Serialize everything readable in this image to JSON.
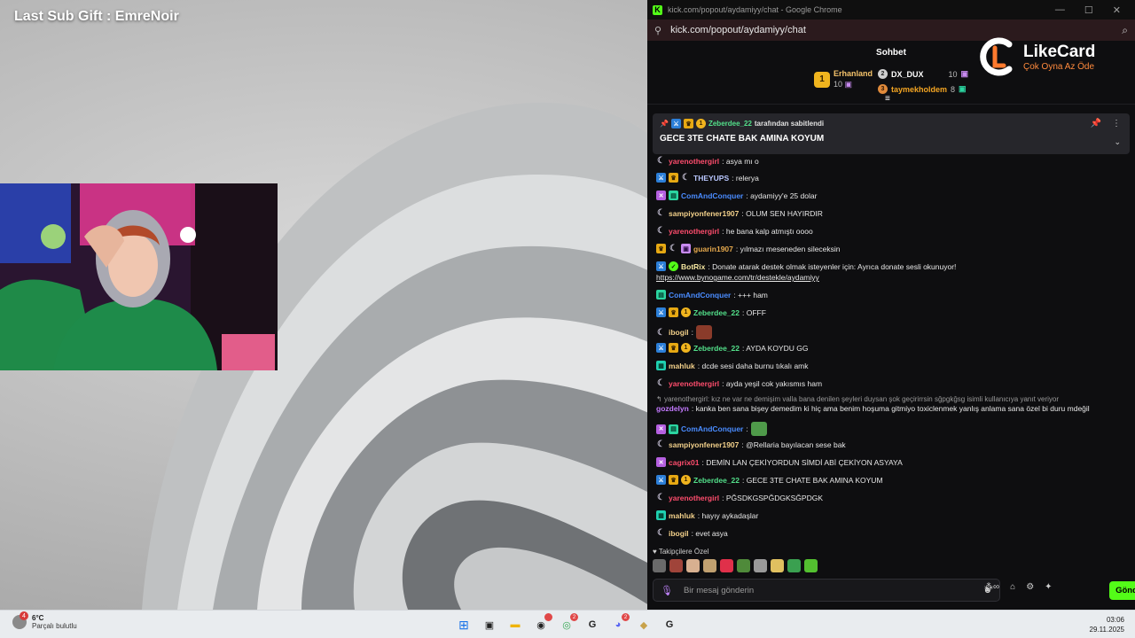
{
  "overlay": {
    "title": "Last Sub Gift : EmreNoir"
  },
  "browser": {
    "window_title": "kick.com/popout/aydamiyy/chat - Google Chrome",
    "url": "kick.com/popout/aydamiyy/chat"
  },
  "chat": {
    "title": "Sohbet",
    "top_gifters": [
      {
        "rank": "1",
        "name": "Erhanland",
        "count": "10",
        "color": "#f5c36b"
      },
      {
        "rank": "2",
        "name": "DX_DUX",
        "count": "10",
        "color": "#ffffff"
      },
      {
        "rank": "3",
        "name": "taymekholdem",
        "count": "8",
        "color": "#f5a623"
      }
    ],
    "pinned": {
      "badge_rank": "1",
      "user": "Zeberdee_22",
      "suffix": "tarafından sabitlendi",
      "message": "GECE 3TE CHATE BAK AMINA KOYUM"
    },
    "messages": [
      {
        "user": "yarenothergirl",
        "text": ": asya mı o",
        "color": "#ff4d6d"
      },
      {
        "user": "THEYUPS",
        "text": ": relerya",
        "color": "#b9c7ff"
      },
      {
        "user": "ComAndConquer",
        "text": ": aydamiyy'e 25 dolar",
        "color": "#4a8cff"
      },
      {
        "user": "sampiyonfener1907",
        "text": ": OLUM SEN HAYIRDIR",
        "color": "#f2d08a"
      },
      {
        "user": "yarenothergirl",
        "text": ": he bana kalp atmıştı oooo",
        "color": "#ff4d6d"
      },
      {
        "user": "guarin1907",
        "text": ": yılmazı meseneden sileceksin",
        "color": "#e6a94d"
      },
      {
        "user": "BotRix",
        "text": ": Donate atarak destek olmak isteyenler için: Ayrıca donate sesli okunuyor!",
        "color": "#f5e6a0",
        "link": "https://www.bynogame.com/tr/destekle/aydamiyy"
      },
      {
        "user": "ComAndConquer",
        "text": ": +++ ham",
        "color": "#4a8cff"
      },
      {
        "user": "Zeberdee_22",
        "text": ": OFFF",
        "color": "#53e08a"
      },
      {
        "user": "ibogil",
        "text": ":",
        "color": "#f2d08a"
      },
      {
        "user": "Zeberdee_22",
        "text": ": AYDA KOYDU GG",
        "color": "#53e08a"
      },
      {
        "user": "mahluk",
        "text": ": dcde sesi daha burnu tıkalı amk",
        "color": "#f2d08a"
      },
      {
        "user": "yarenothergirl",
        "text": ": ayda yeşil cok yakısmıs ham",
        "color": "#ff4d6d"
      },
      {
        "user": "gozdelyn",
        "text": ": kanka ben sana bişey demedim ki hiç ama benim hoşuma gitmiyo toxiclenmek yanlış anlama sana özel bi duru mdeğil",
        "color": "#c47aff",
        "reply": "yarenothergirl: kız ne var ne demişim valla bana denilen şeyleri duysan şok geçirirrsin sğpgkğsg isimli kullanıcıya yanıt veriyor"
      },
      {
        "user": "ComAndConquer",
        "text": ":",
        "color": "#4a8cff"
      },
      {
        "user": "sampiyonfener1907",
        "text": ": @Rellaria bayılacan sese bak",
        "color": "#f2d08a"
      },
      {
        "user": "cagrix01",
        "text": ": DEMİN LAN ÇEKİYORDUN SİMDİ ABİ ÇEKİYON ASYAYA",
        "color": "#ff4d6d"
      },
      {
        "user": "Zeberdee_22",
        "text": ": GECE 3TE CHATE BAK AMINA KOYUM",
        "color": "#53e08a"
      },
      {
        "user": "yarenothergirl",
        "text": ": PĞSDKGSPĞDGKSĞPDGK",
        "color": "#ff4d6d"
      },
      {
        "user": "mahluk",
        "text": ": hayıy aykadaşlar",
        "color": "#f2d08a"
      },
      {
        "user": "ibogil",
        "text": ": evet asya",
        "color": "#f2d08a"
      }
    ],
    "followers_label": "Takipçilere Özel",
    "input_placeholder": "Bir mesaj gönderin",
    "send_label": "Gönder"
  },
  "ad": {
    "brand": "LikeCard",
    "tagline": "Çok Oyna  Az Öde"
  },
  "taskbar": {
    "weather_badge": "4",
    "temperature": "6°C",
    "condition": "Parçalı bulutlu",
    "chrome_badge": "2",
    "discord_badge": "2",
    "time": "03:06",
    "date": "29.11.2025"
  }
}
